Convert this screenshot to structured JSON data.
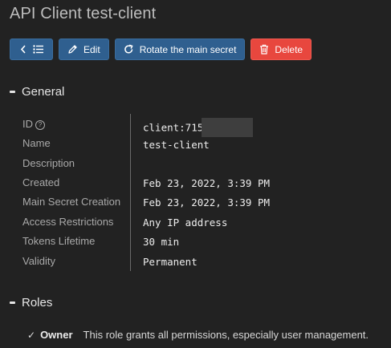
{
  "page": {
    "title": "API Client test-client"
  },
  "toolbar": {
    "edit_label": "Edit",
    "rotate_label": "Rotate the main secret",
    "delete_label": "Delete"
  },
  "sections": {
    "general": "General",
    "roles": "Roles"
  },
  "fields": {
    "id": {
      "label": "ID",
      "value": "client:715"
    },
    "name": {
      "label": "Name",
      "value": "test-client"
    },
    "description": {
      "label": "Description",
      "value": ""
    },
    "created": {
      "label": "Created",
      "value": "Feb 23, 2022, 3:39 PM"
    },
    "main_secret_creation": {
      "label": "Main Secret Creation",
      "value": "Feb 23, 2022, 3:39 PM"
    },
    "access_restrictions": {
      "label": "Access Restrictions",
      "value": "Any IP address"
    },
    "tokens_lifetime": {
      "label": "Tokens Lifetime",
      "value": "30 min"
    },
    "validity": {
      "label": "Validity",
      "value": "Permanent"
    }
  },
  "roles": [
    {
      "check": "✓",
      "name": "Owner",
      "description": "This role grants all permissions, especially user management."
    }
  ],
  "colors": {
    "primary": "#2f5f8f",
    "danger": "#e8473e",
    "background": "#222222"
  },
  "icons": {
    "back": "chevron-left-icon",
    "list": "list-icon",
    "edit": "pencil-icon",
    "rotate": "rotate-icon",
    "delete": "trash-icon",
    "help": "help-circle-icon"
  }
}
